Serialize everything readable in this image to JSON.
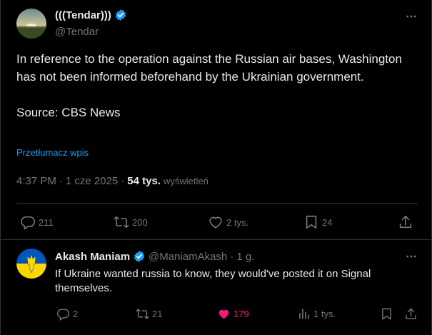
{
  "tweet": {
    "display_name": "(((Tendar)))",
    "handle": "@Tendar",
    "text": "In reference to the operation against the Russian air bases, Washington has not been informed beforehand by the Ukrainian government.\n\nSource: CBS News",
    "translate_label": "Przetłumacz wpis",
    "time": "4:37 PM",
    "sep1": "·",
    "date": "1 cze 2025",
    "sep2": "·",
    "views": "54 tys.",
    "views_label": "wyświetleń",
    "more_icon": "more-dots-icon",
    "stats": {
      "replies": "211",
      "reposts": "200",
      "likes": "2 tys.",
      "bookmarks": "24"
    }
  },
  "reply": {
    "display_name": "Akash Maniam",
    "handle": "@ManiamAkash",
    "sep": "·",
    "time": "1 g.",
    "text": "If Ukraine wanted russia to know, they would've posted it on Signal themselves.",
    "stats": {
      "replies": "2",
      "reposts": "21",
      "likes": "179",
      "views": "1 tys."
    }
  },
  "colors": {
    "background": "#000000",
    "text": "#e7e9ea",
    "muted": "#71767b",
    "accent": "#1d9bf0",
    "like_active": "#f91880",
    "border": "#2f3336"
  }
}
